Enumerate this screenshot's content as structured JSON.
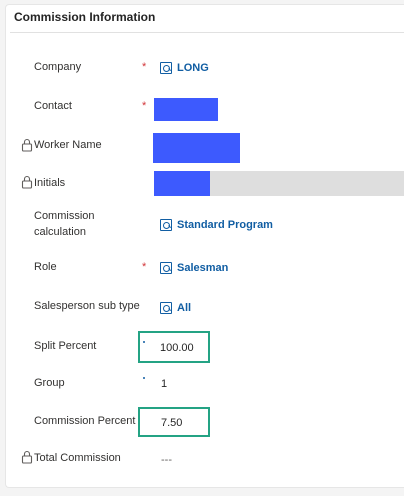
{
  "section": {
    "title": "Commission Information"
  },
  "fields": {
    "company": {
      "label": "Company",
      "value": "LONG"
    },
    "contact": {
      "label": "Contact"
    },
    "worker": {
      "label": "Worker Name"
    },
    "initials": {
      "label": "Initials"
    },
    "commission_calc": {
      "label_line1": "Commission",
      "label_line2": "calculation",
      "value": "Standard Program"
    },
    "role": {
      "label": "Role",
      "value": "Salesman"
    },
    "sub_type": {
      "label": "Salesperson sub type",
      "value": "All"
    },
    "split": {
      "label": "Split Percent",
      "value": "100.00"
    },
    "group": {
      "label": "Group",
      "value": "1"
    },
    "comm_pct": {
      "label": "Commission Percent",
      "value": "7.50"
    },
    "total": {
      "label": "Total Commission",
      "value": "---"
    }
  },
  "required_marker": "*",
  "colors": {
    "link": "#115ea3",
    "required": "#d13438",
    "highlight": "#24a384",
    "redaction": "#3d5afe"
  }
}
